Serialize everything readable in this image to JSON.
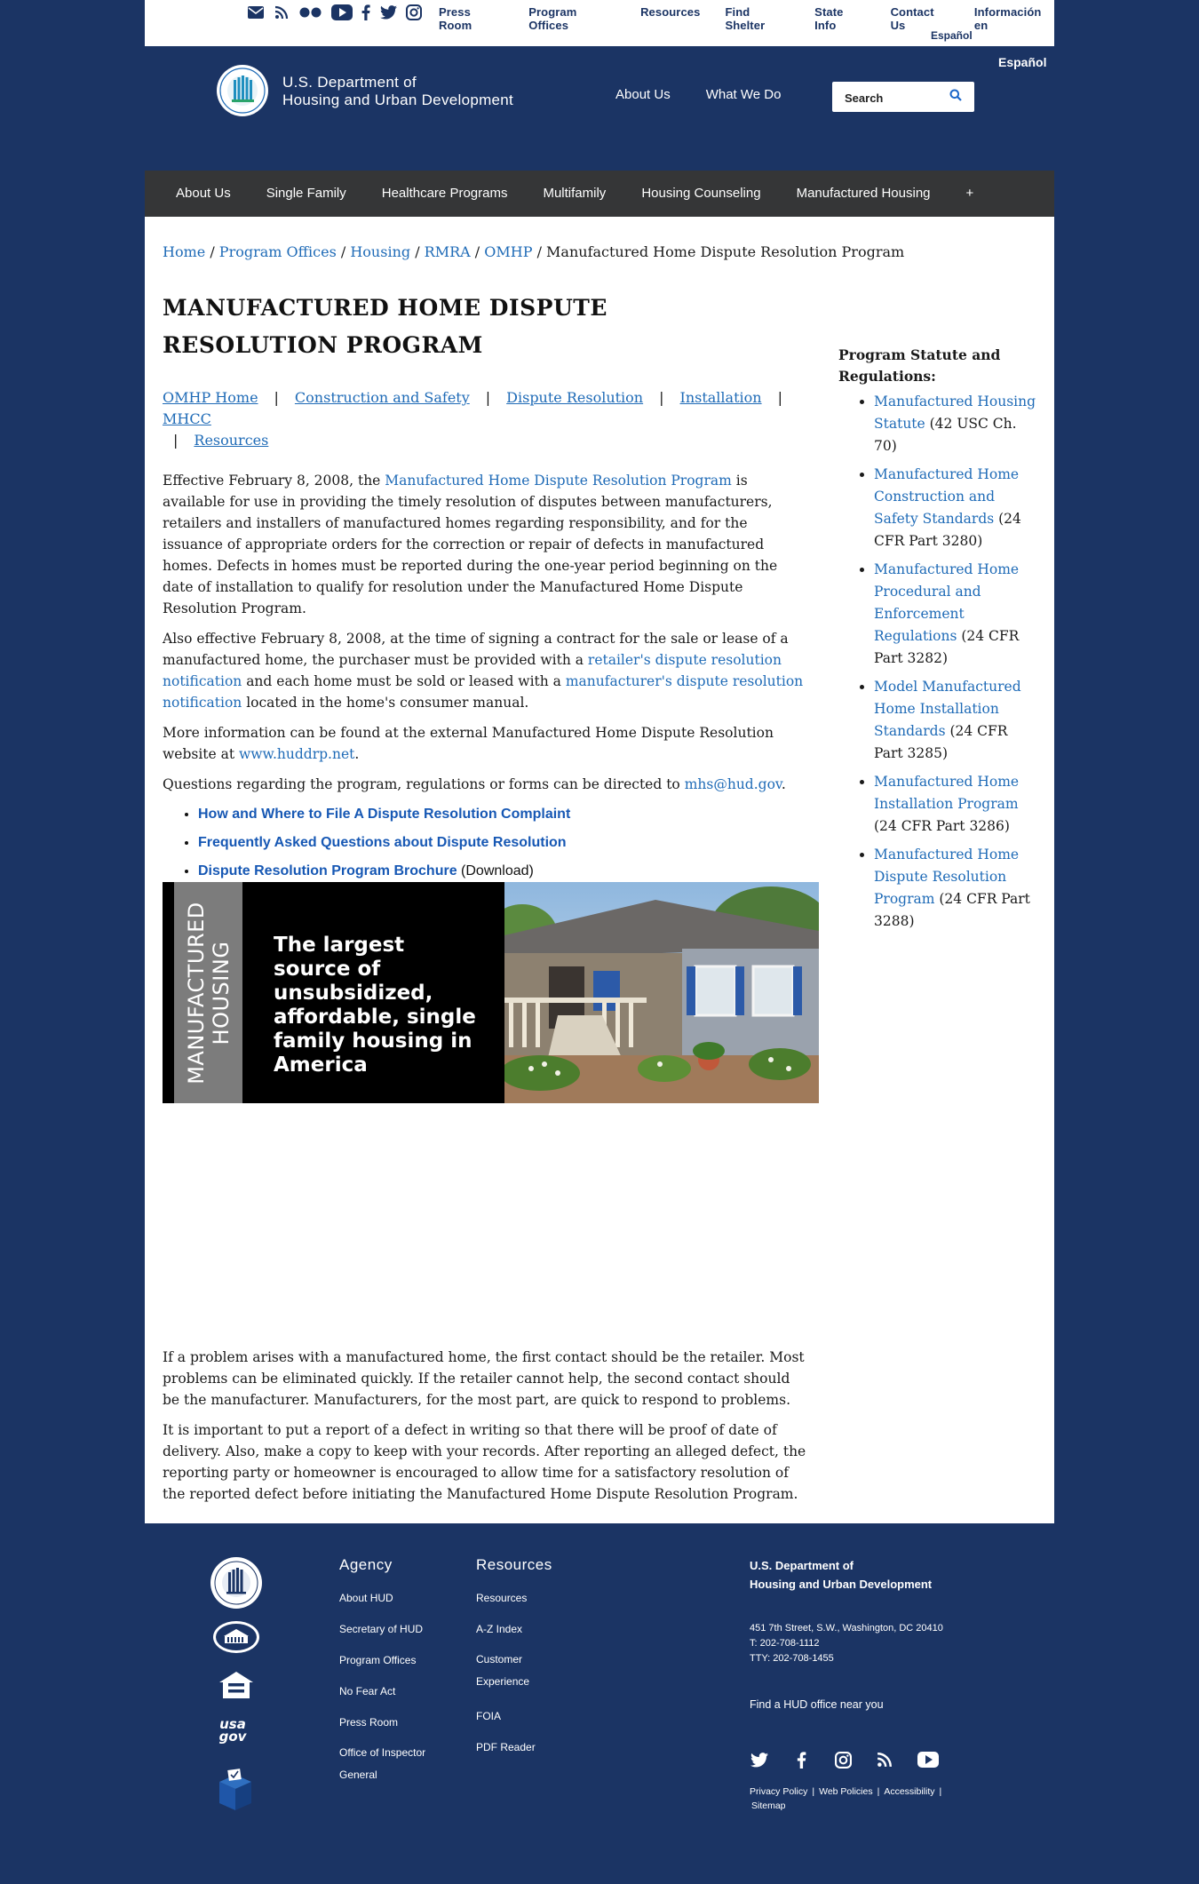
{
  "utility_bar": {
    "links": [
      "Press Room",
      "Program Offices",
      "Resources",
      "Find Shelter",
      "State Info",
      "Contact Us",
      "Información en"
    ],
    "espanol_line2": "Español",
    "icons": [
      "email-icon",
      "rss-icon",
      "flickr-icon",
      "youtube-icon",
      "facebook-icon",
      "twitter-icon",
      "instagram-icon"
    ]
  },
  "header": {
    "espanol": "Español",
    "agency_line1": "U.S. Department of",
    "agency_line2": "Housing and Urban Development",
    "nav": [
      "About Us",
      "What We Do"
    ],
    "search_placeholder": "Search"
  },
  "main_nav": [
    "About Us",
    "Single Family",
    "Healthcare Programs",
    "Multifamily",
    "Housing Counseling",
    "Manufactured Housing",
    "+"
  ],
  "breadcrumb": {
    "links": [
      "Home",
      "Program Offices",
      "Housing",
      "RMRA",
      "OMHP"
    ],
    "current": "Manufactured Home Dispute Resolution Program"
  },
  "page_title": "MANUFACTURED HOME DISPUTE RESOLUTION PROGRAM",
  "subnav": [
    "OMHP Home",
    "Construction and Safety",
    "Dispute Resolution",
    "Installation",
    "MHCC",
    "Resources"
  ],
  "body": {
    "p1_a": "Effective February 8, 2008, the ",
    "p1_link": "Manufactured Home Dispute Resolution Program",
    "p1_b": " is available for use in providing the timely resolution of disputes between manufacturers, retailers and installers of manufactured homes regarding responsibility, and for the issuance of appropriate orders for the correction or repair of defects in manufactured homes. Defects in homes must be reported during the one-year period beginning on the date of installation to qualify for resolution under the Manufactured Home Dispute Resolution Program.",
    "p2_a": "Also effective February 8, 2008, at the time of signing a contract for the sale or lease of a manufactured home, the purchaser must be provided with a ",
    "p2_link1": "retailer's dispute resolution notification",
    "p2_b": " and each home must be sold or leased with a ",
    "p2_link2": "manufacturer's dispute resolution notification",
    "p2_c": " located in the home's consumer manual.",
    "p3_a": "More information can be found at the external Manufactured Home Dispute Resolution website at ",
    "p3_link": "www.huddrp.net",
    "p3_b": ".",
    "p4_a": "Questions regarding the program, regulations or forms can be directed to ",
    "p4_link": "mhs@hud.gov",
    "p4_b": ".",
    "doc_links": [
      {
        "label": "How and Where to File A Dispute Resolution Complaint",
        "suffix": ""
      },
      {
        "label": "Frequently Asked Questions about Dispute Resolution",
        "suffix": ""
      },
      {
        "label": "Dispute Resolution Program Brochure",
        "suffix": " (Download)"
      }
    ]
  },
  "banner": {
    "vertical_line1": "MANUFACTURED",
    "vertical_line2": "HOUSING",
    "tagline": "The largest source of unsubsidized, affordable, single family housing in America"
  },
  "lower": {
    "p1": "If a problem arises with a manufactured home, the first contact should be the retailer. Most problems can be eliminated quickly. If the retailer cannot help, the second contact should be the manufacturer. Manufacturers, for the most part, are quick to respond to problems.",
    "p2": "It is important to put a report of a defect in writing so that there will be proof of date of delivery. Also, make a copy to keep with your records. After reporting an alleged defect, the reporting party or homeowner is encouraged to allow time for a satisfactory resolution of the reported defect before initiating the Manufactured Home Dispute Resolution Program."
  },
  "sidebar": {
    "title": "Program Statute and Regulations:",
    "items": [
      {
        "link": "Manufactured Housing Statute",
        "suffix": " (42 USC Ch. 70)"
      },
      {
        "link": "Manufactured Home Construction and Safety Standards",
        "suffix": " (24 CFR Part 3280)"
      },
      {
        "link": "Manufactured Home Procedural and Enforcement Regulations",
        "suffix": " (24 CFR Part 3282)"
      },
      {
        "link": "Model Manufactured Home Installation Standards",
        "suffix": " (24 CFR Part 3285)"
      },
      {
        "link": "Manufactured Home Installation Program",
        "suffix": " (24 CFR Part 3286)"
      },
      {
        "link": "Manufactured Home Dispute Resolution Program",
        "suffix": " (24 CFR Part 3288)"
      }
    ]
  },
  "footer": {
    "agency_title": "Agency",
    "agency_links": [
      "About HUD",
      "Secretary of HUD",
      "Program Offices",
      "No Fear Act",
      "Press Room",
      "Office of Inspector General"
    ],
    "resources_title": "Resources",
    "resources_links": [
      "Resources",
      "A-Z Index",
      "Customer Experience",
      "FOIA",
      "PDF Reader"
    ],
    "dept_line1": "U.S. Department of",
    "dept_line2": "Housing and Urban Development",
    "address": "451 7th Street, S.W., Washington, DC 20410",
    "phone": "T: 202-708-1112",
    "tty": "TTY: 202-708-1455",
    "find_office": "Find a HUD office near you",
    "policy_links": [
      "Privacy Policy",
      "Web Policies",
      "Accessibility",
      "Sitemap"
    ],
    "usagov_label": "usa gov"
  }
}
